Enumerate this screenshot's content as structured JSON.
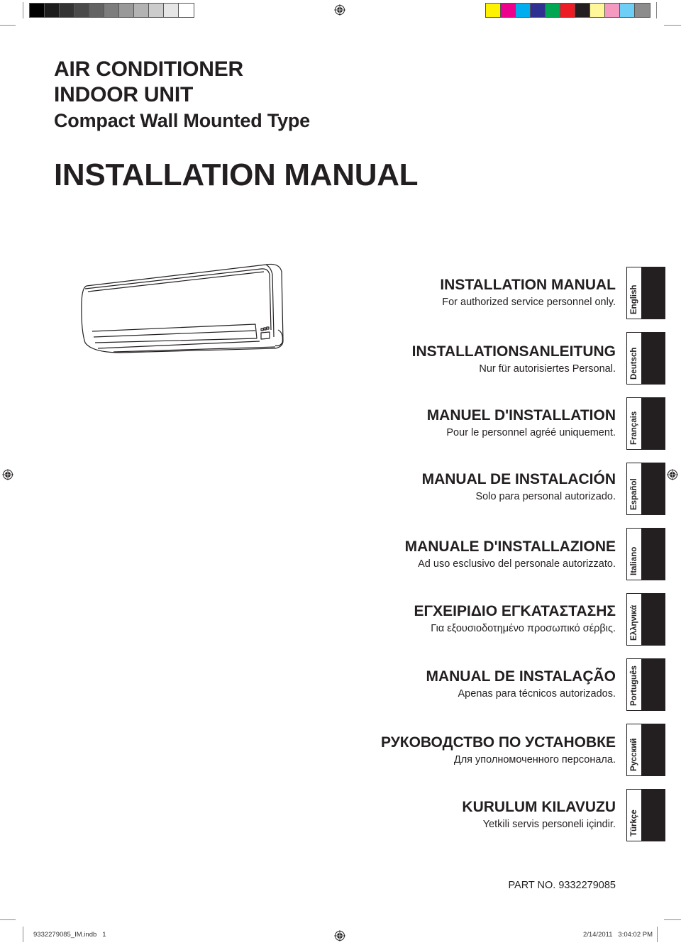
{
  "print_marks": {
    "grayscale_swatches": [
      "#000000",
      "#1c1c1c",
      "#333333",
      "#4a4a4a",
      "#636363",
      "#7d7d7d",
      "#999999",
      "#b3b3b3",
      "#cccccc",
      "#e6e6e6",
      "#ffffff"
    ],
    "color_swatches": [
      "#fff200",
      "#ec008c",
      "#00aeef",
      "#2e3192",
      "#00a651",
      "#ed1c24",
      "#231f20",
      "#fff799",
      "#f49ac1",
      "#6dcff6",
      "#8c8c8c"
    ]
  },
  "header": {
    "line1": "AIR CONDITIONER",
    "line2": "INDOOR UNIT",
    "line3": "Compact Wall Mounted Type",
    "main_title": "INSTALLATION MANUAL"
  },
  "languages": [
    {
      "title": "INSTALLATION MANUAL",
      "subtitle": "For authorized service personnel only.",
      "tab": "English"
    },
    {
      "title": "INSTALLATIONSANLEITUNG",
      "subtitle": "Nur für autorisiertes Personal.",
      "tab": "Deutsch"
    },
    {
      "title": "MANUEL D'INSTALLATION",
      "subtitle": "Pour le personnel agréé uniquement.",
      "tab": "Français"
    },
    {
      "title": "MANUAL DE INSTALACIÓN",
      "subtitle": "Solo para personal autorizado.",
      "tab": "Español"
    },
    {
      "title": "MANUALE D'INSTALLAZIONE",
      "subtitle": "Ad uso esclusivo del personale autorizzato.",
      "tab": "Italiano"
    },
    {
      "title": "ΕΓΧΕΙΡΙΔΙΟ ΕΓΚΑΤΑΣΤΑΣΗΣ",
      "subtitle": "Για εξουσιοδοτημένο προσωπικό σέρβις.",
      "tab": "Ελληνικά"
    },
    {
      "title": "MANUAL DE INSTALAÇÃO",
      "subtitle": "Apenas para técnicos autorizados.",
      "tab": "Português"
    },
    {
      "title": "РУКОВОДСТВО ПО УСТАНОВКЕ",
      "subtitle": "Для уполномоченного персонала.",
      "tab": "Русский"
    },
    {
      "title": "KURULUM KILAVUZU",
      "subtitle": "Yetkili servis personeli içindir.",
      "tab": "Türkçe"
    }
  ],
  "part_number": "PART NO. 9332279085",
  "footer": {
    "file": "9332279085_IM.indb   1",
    "timestamp": "2/14/2011   3:04:02 PM"
  },
  "icons": {
    "registration_mark": "crosshair-target-icon",
    "product_illustration": "wall-mounted-air-conditioner"
  }
}
